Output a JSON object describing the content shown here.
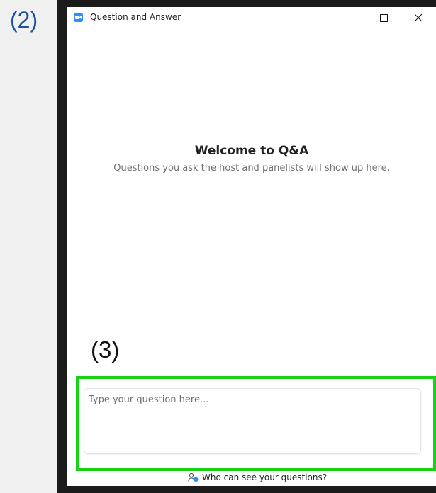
{
  "annotations": {
    "step_2": "(2)",
    "step_3": "(3)"
  },
  "window": {
    "title": "Question and Answer",
    "controls": {
      "minimize_icon": "minimize-icon",
      "maximize_icon": "maximize-icon",
      "close_icon": "close-icon"
    }
  },
  "welcome": {
    "title": "Welcome to Q&A",
    "subtitle": "Questions you ask the host and panelists will show up here."
  },
  "question_box": {
    "placeholder": "Type your question here...",
    "value": ""
  },
  "visibility_link": {
    "label": "Who can see your questions?",
    "icon": "people-icon"
  },
  "colors": {
    "accent_blue": "#2d8cff",
    "highlight_green": "#16d313",
    "frame_dark": "#1b1b1b"
  }
}
